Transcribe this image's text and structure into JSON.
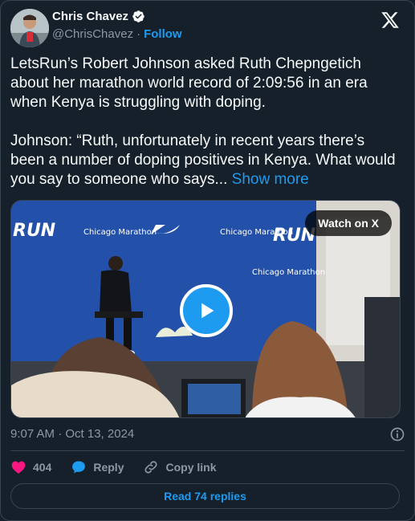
{
  "author": {
    "name": "Chris Chavez",
    "handle": "@ChrisChavez",
    "separator": "·",
    "follow_label": "Follow"
  },
  "tweet": {
    "text": "LetsRun’s Robert Johnson asked Ruth Chepngetich about her marathon world record of 2:09:56 in an era when Kenya is struggling with doping.\n\nJohnson: “Ruth, unfortunately in recent years there’s been a number of doping positives in Kenya. What would you say to someone who says... ",
    "show_more": "Show more"
  },
  "media": {
    "watch_label": "Watch on X",
    "backdrop_texts": [
      "RUN",
      "Chicago Marathon",
      "Chicago Marathon",
      "Chicago Marathon",
      "RUN"
    ]
  },
  "meta": {
    "timestamp": "9:07 AM · Oct 13, 2024"
  },
  "actions": {
    "likes": "404",
    "reply_label": "Reply",
    "copy_label": "Copy link"
  },
  "footer": {
    "read_replies": "Read 74 replies"
  },
  "colors": {
    "background": "#15202b",
    "accent": "#1d9bf0",
    "like": "#f91880",
    "muted": "#8b98a5"
  }
}
